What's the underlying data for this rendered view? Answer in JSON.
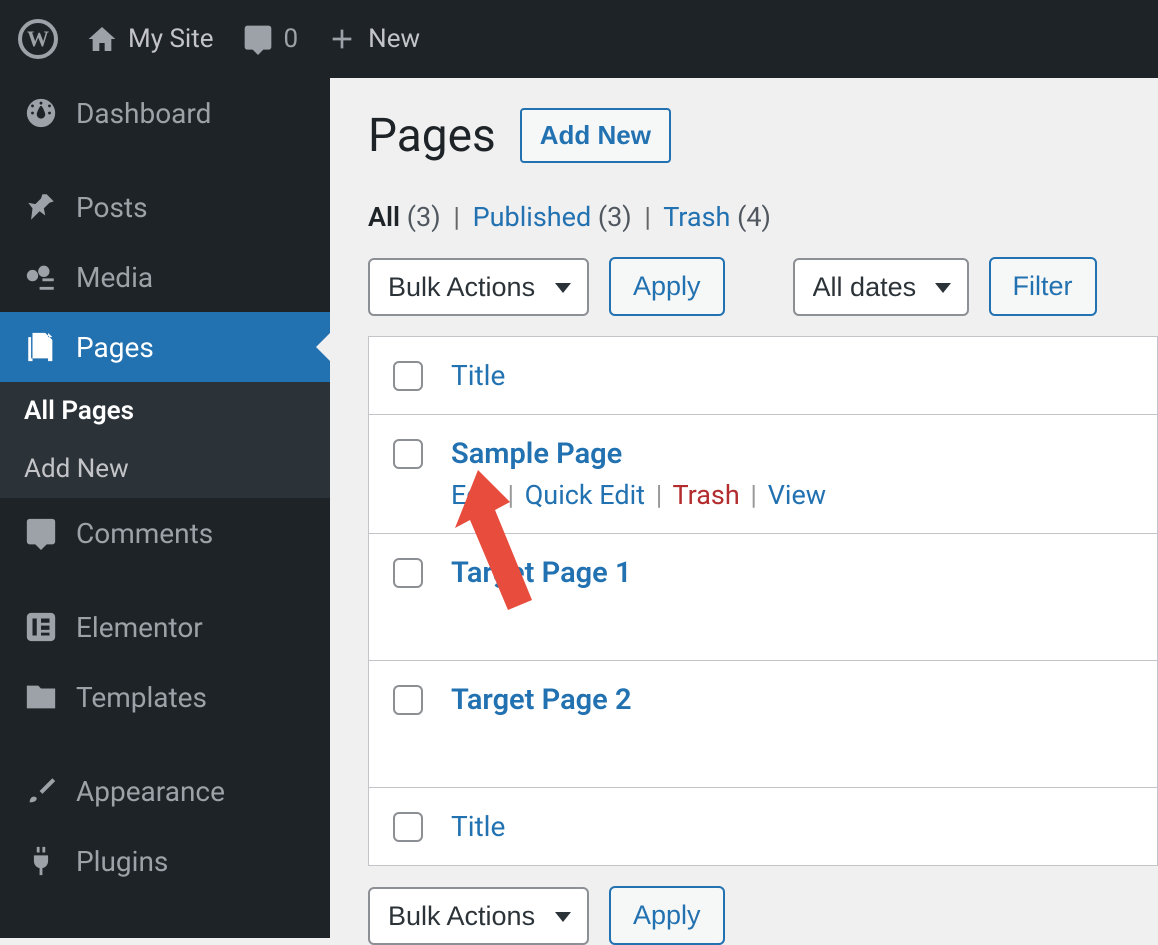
{
  "adminbar": {
    "site_name": "My Site",
    "comments_count": "0",
    "new_label": "New"
  },
  "sidebar": {
    "items": [
      {
        "id": "dashboard",
        "label": "Dashboard"
      },
      {
        "id": "posts",
        "label": "Posts"
      },
      {
        "id": "media",
        "label": "Media"
      },
      {
        "id": "pages",
        "label": "Pages"
      },
      {
        "id": "comments",
        "label": "Comments"
      },
      {
        "id": "elementor",
        "label": "Elementor"
      },
      {
        "id": "templates",
        "label": "Templates"
      },
      {
        "id": "appearance",
        "label": "Appearance"
      },
      {
        "id": "plugins",
        "label": "Plugins"
      }
    ],
    "pages_submenu": {
      "all_pages": "All Pages",
      "add_new": "Add New"
    }
  },
  "header": {
    "title": "Pages",
    "add_new": "Add New"
  },
  "filters": {
    "all": {
      "label": "All",
      "count": "(3)"
    },
    "published": {
      "label": "Published",
      "count": "(3)"
    },
    "trash": {
      "label": "Trash",
      "count": "(4)"
    }
  },
  "tablenav": {
    "bulk_actions": "Bulk Actions",
    "apply": "Apply",
    "all_dates": "All dates",
    "filter": "Filter"
  },
  "table": {
    "title_col": "Title",
    "rows": [
      {
        "title": "Sample Page",
        "actions": {
          "edit": "Edit",
          "quick_edit": "Quick Edit",
          "trash": "Trash",
          "view": "View"
        },
        "show_actions": true
      },
      {
        "title": "Target Page 1",
        "show_actions": false
      },
      {
        "title": "Target Page 2",
        "show_actions": false
      }
    ]
  }
}
